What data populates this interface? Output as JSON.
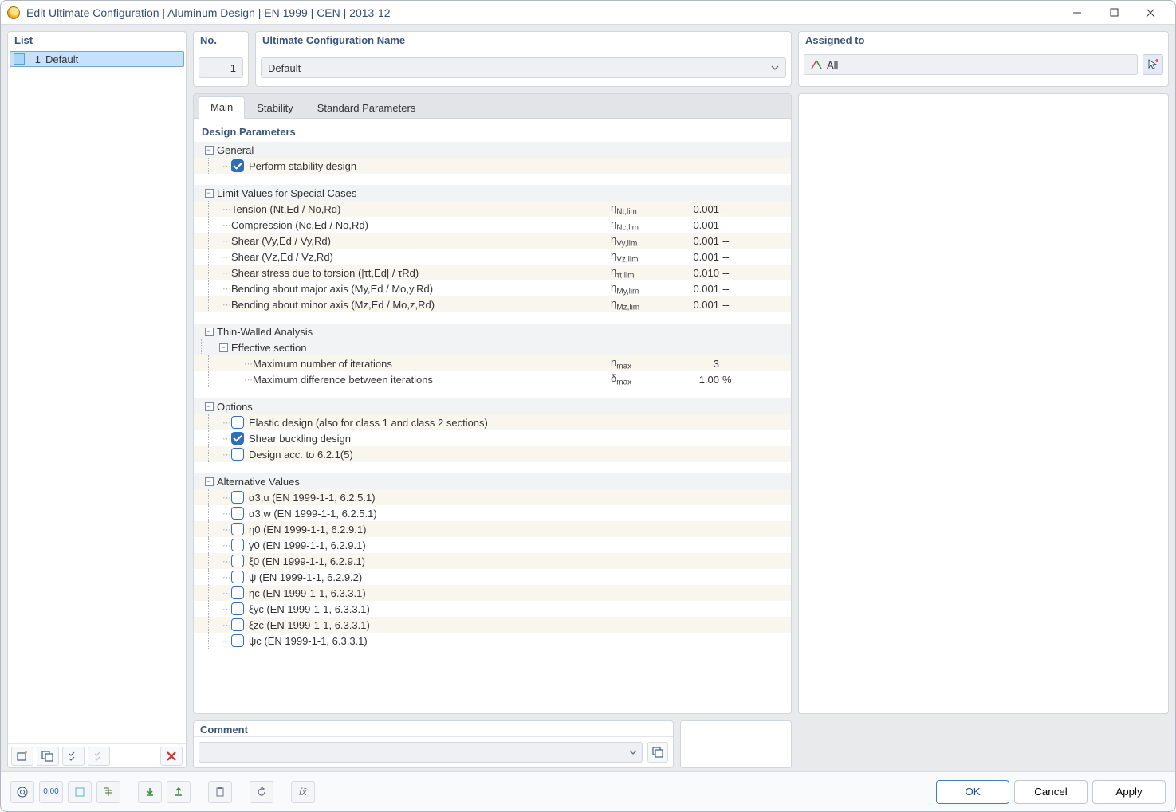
{
  "window": {
    "title": "Edit Ultimate Configuration | Aluminum Design | EN 1999 | CEN | 2013-12"
  },
  "sidebar": {
    "header": "List",
    "items": [
      {
        "number": "1",
        "name": "Default",
        "selected": true
      }
    ]
  },
  "top": {
    "no": {
      "header": "No.",
      "value": "1"
    },
    "name": {
      "header": "Ultimate Configuration Name",
      "value": "Default"
    },
    "assigned": {
      "header": "Assigned to",
      "value": "All"
    }
  },
  "tabs": {
    "items": [
      "Main",
      "Stability",
      "Standard Parameters"
    ],
    "active": 0
  },
  "section_title": "Design Parameters",
  "groups": {
    "general": {
      "label": "General",
      "perform_stability": {
        "label": "Perform stability design",
        "checked": true
      }
    },
    "limits": {
      "label": "Limit Values for Special Cases",
      "rows": [
        {
          "label": "Tension (Nt,Ed / No,Rd)",
          "sym_html": "η<sub>Nt,lim</sub>",
          "value": "0.001",
          "unit": "--"
        },
        {
          "label": "Compression (Nc,Ed / No,Rd)",
          "sym_html": "η<sub>Nc,lim</sub>",
          "value": "0.001",
          "unit": "--"
        },
        {
          "label": "Shear (Vy,Ed / Vy,Rd)",
          "sym_html": "η<sub>Vy,lim</sub>",
          "value": "0.001",
          "unit": "--"
        },
        {
          "label": "Shear (Vz,Ed / Vz,Rd)",
          "sym_html": "η<sub>Vz,lim</sub>",
          "value": "0.001",
          "unit": "--"
        },
        {
          "label": "Shear stress due to torsion (|τt,Ed| / τRd)",
          "sym_html": "η<sub>τt,lim</sub>",
          "value": "0.010",
          "unit": "--"
        },
        {
          "label": "Bending about major axis (My,Ed / Mo,y,Rd)",
          "sym_html": "η<sub>My,lim</sub>",
          "value": "0.001",
          "unit": "--"
        },
        {
          "label": "Bending about minor axis (Mz,Ed / Mo,z,Rd)",
          "sym_html": "η<sub>Mz,lim</sub>",
          "value": "0.001",
          "unit": "--"
        }
      ]
    },
    "thin": {
      "label": "Thin-Walled Analysis",
      "effective": "Effective section",
      "rows": [
        {
          "label": "Maximum number of iterations",
          "sym_html": "n<sub>max</sub>",
          "value": "3",
          "unit": ""
        },
        {
          "label": "Maximum difference between iterations",
          "sym_html": "δ<sub>max</sub>",
          "value": "1.00",
          "unit": "%"
        }
      ]
    },
    "options": {
      "label": "Options",
      "rows": [
        {
          "label": "Elastic design (also for class 1 and class 2 sections)",
          "checked": false
        },
        {
          "label": "Shear buckling design",
          "checked": true
        },
        {
          "label": "Design acc. to 6.2.1(5)",
          "checked": false
        }
      ]
    },
    "alt": {
      "label": "Alternative Values",
      "rows": [
        {
          "label": "α3,u (EN 1999-1-1, 6.2.5.1)",
          "checked": false
        },
        {
          "label": "α3,w (EN 1999-1-1, 6.2.5.1)",
          "checked": false
        },
        {
          "label": "η0 (EN 1999-1-1, 6.2.9.1)",
          "checked": false
        },
        {
          "label": "γ0 (EN 1999-1-1, 6.2.9.1)",
          "checked": false
        },
        {
          "label": "ξ0 (EN 1999-1-1, 6.2.9.1)",
          "checked": false
        },
        {
          "label": "ψ (EN 1999-1-1, 6.2.9.2)",
          "checked": false
        },
        {
          "label": "ηc (EN 1999-1-1, 6.3.3.1)",
          "checked": false
        },
        {
          "label": "ξyc (EN 1999-1-1, 6.3.3.1)",
          "checked": false
        },
        {
          "label": "ξzc (EN 1999-1-1, 6.3.3.1)",
          "checked": false
        },
        {
          "label": "ψc (EN 1999-1-1, 6.3.3.1)",
          "checked": false
        }
      ]
    }
  },
  "comment": {
    "header": "Comment",
    "value": ""
  },
  "buttons": {
    "ok": "OK",
    "cancel": "Cancel",
    "apply": "Apply"
  }
}
